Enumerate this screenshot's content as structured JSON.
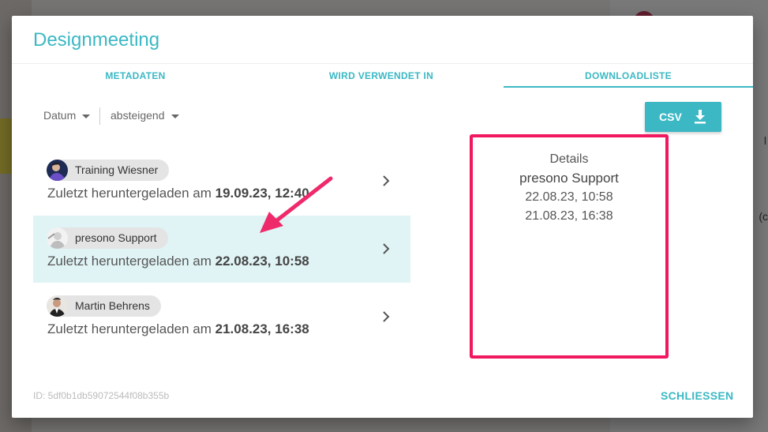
{
  "dialog": {
    "title": "Designmeeting",
    "tabs": [
      {
        "label": "METADATEN"
      },
      {
        "label": "WIRD VERWENDET IN"
      },
      {
        "label": "DOWNLOADLISTE"
      }
    ],
    "active_tab": "DOWNLOADLISTE",
    "sort": {
      "field": "Datum",
      "order": "absteigend"
    },
    "csv_label": "CSV",
    "downloads": [
      {
        "name": "Training Wiesner",
        "prefix": "Zuletzt heruntergeladen am ",
        "date": "19.09.23, 12:40"
      },
      {
        "name": "presono Support",
        "prefix": "Zuletzt heruntergeladen am ",
        "date": "22.08.23, 10:58"
      },
      {
        "name": "Martin Behrens",
        "prefix": "Zuletzt heruntergeladen am ",
        "date": "21.08.23, 16:38"
      }
    ],
    "details": {
      "heading": "Details",
      "name": "presono Support",
      "dates": [
        "22.08.23, 10:58",
        "21.08.23, 16:38"
      ]
    },
    "footer_id": "ID: 5df0b1db59072544f08b355b",
    "close_label": "SCHLIESSEN"
  },
  "background": {
    "fragment_1": "l",
    "fragment_2": "(c"
  },
  "colors": {
    "accent": "#3bb8c4",
    "highlight": "#f0185e",
    "selected_row": "#e0f3f5"
  }
}
